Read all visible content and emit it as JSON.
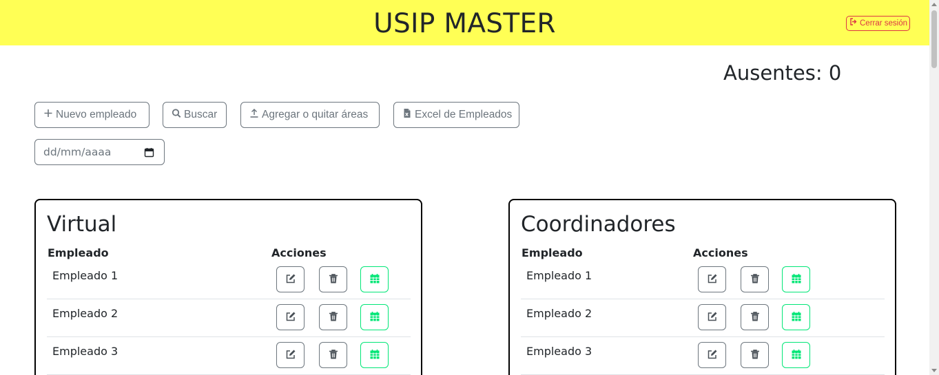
{
  "header": {
    "title": "USIP MASTER",
    "logout_label": "Cerrar sesión"
  },
  "absent": {
    "label": "Ausentes: 0"
  },
  "toolbar": {
    "new_employee_label": "Nuevo empleado",
    "search_label": "Buscar",
    "areas_label": "Agregar o quitar áreas",
    "excel_label": "Excel de Empleados"
  },
  "date_filter": {
    "placeholder": "dd/mm/aaaa"
  },
  "cards": [
    {
      "title": "Virtual",
      "col_employee": "Empleado",
      "col_actions": "Acciones",
      "rows": [
        {
          "name": "Empleado 1"
        },
        {
          "name": "Empleado 2"
        },
        {
          "name": "Empleado 3"
        }
      ]
    },
    {
      "title": "Coordinadores",
      "col_employee": "Empleado",
      "col_actions": "Acciones",
      "rows": [
        {
          "name": "Empleado 1"
        },
        {
          "name": "Empleado 2"
        },
        {
          "name": "Empleado 3"
        }
      ]
    }
  ],
  "icons": {
    "logout": "sign-out-icon",
    "new": "plus-icon",
    "search": "search-icon",
    "areas": "upload-icon",
    "excel": "file-excel-icon",
    "date": "calendar-icon",
    "edit": "edit-icon",
    "delete": "trash-icon",
    "schedule": "calendar-grid-icon"
  },
  "colors": {
    "header_bg": "#ffff55",
    "danger": "#dc3545",
    "secondary": "#6c757d",
    "success": "#00e676"
  }
}
